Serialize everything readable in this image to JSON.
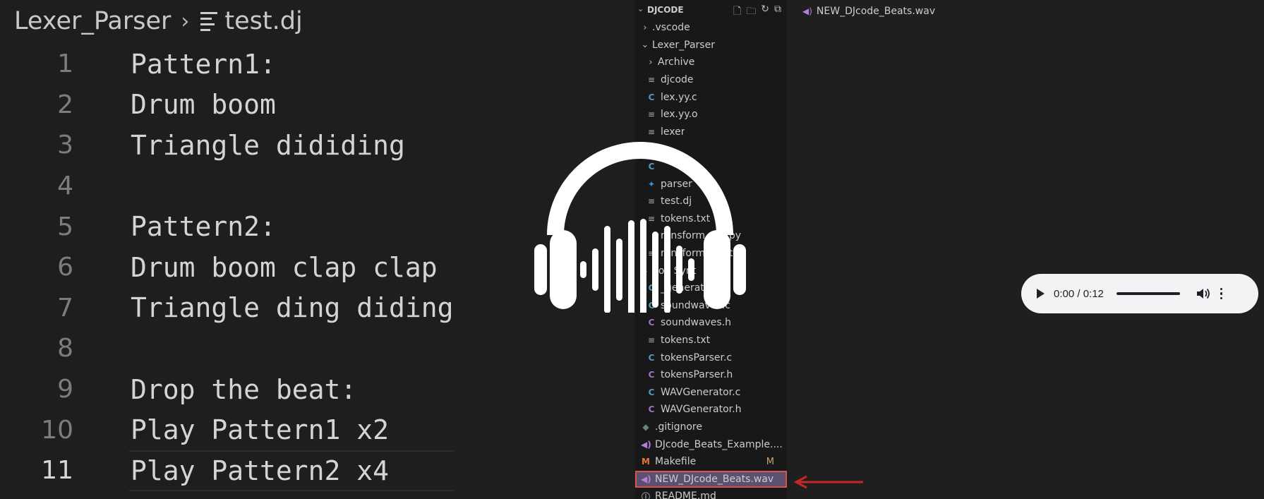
{
  "breadcrumb": {
    "folder": "Lexer_Parser",
    "separator": "›",
    "file": "test.dj"
  },
  "editor": {
    "active_line": 11,
    "lines": [
      {
        "num": "1",
        "text": "Pattern1:"
      },
      {
        "num": "2",
        "text": "Drum boom"
      },
      {
        "num": "3",
        "text": "Triangle dididing"
      },
      {
        "num": "4",
        "text": ""
      },
      {
        "num": "5",
        "text": "Pattern2:"
      },
      {
        "num": "6",
        "text": "Drum boom clap clap"
      },
      {
        "num": "7",
        "text": "Triangle ding diding"
      },
      {
        "num": "8",
        "text": ""
      },
      {
        "num": "9",
        "text": "Drop the beat:"
      },
      {
        "num": "10",
        "text": "Play Pattern1 x2"
      },
      {
        "num": "11",
        "text": "Play Pattern2 x4"
      }
    ]
  },
  "explorer": {
    "title": "DJCODE",
    "items": [
      {
        "label": ".vscode",
        "indent": 1,
        "chevron": "›",
        "icon": "folder"
      },
      {
        "label": "Lexer_Parser",
        "indent": 1,
        "chevron": "⌄",
        "icon": "folder"
      },
      {
        "label": "Archive",
        "indent": 2,
        "chevron": "›",
        "icon": "folder"
      },
      {
        "label": "djcode",
        "indent": 2,
        "chevron": "",
        "icon": "lines"
      },
      {
        "label": "lex.yy.c",
        "indent": 2,
        "chevron": "",
        "icon": "c"
      },
      {
        "label": "lex.yy.o",
        "indent": 2,
        "chevron": "",
        "icon": "lines"
      },
      {
        "label": "lexer",
        "indent": 2,
        "chevron": "",
        "icon": "lines"
      },
      {
        "label": "",
        "indent": 2,
        "chevron": "",
        "icon": "lines"
      },
      {
        "label": "",
        "indent": 2,
        "chevron": "",
        "icon": "c"
      },
      {
        "label": "parser",
        "indent": 2,
        "chevron": "",
        "icon": "py"
      },
      {
        "label": "test.dj",
        "indent": 2,
        "chevron": "",
        "icon": "lines"
      },
      {
        "label": "tokens.txt",
        "indent": 2,
        "chevron": "",
        "icon": "lines"
      },
      {
        "label": "ransform ens.py",
        "indent": 2,
        "chevron": "",
        "icon": "none"
      },
      {
        "label": "ransform ens.txt",
        "indent": 2,
        "chevron": "",
        "icon": "lines"
      },
      {
        "label": "Sou Synt",
        "indent": 1,
        "chevron": "⌄",
        "icon": "folder"
      },
      {
        "label": "_generat",
        "indent": 2,
        "chevron": "",
        "icon": "c"
      },
      {
        "label": "soundwaves.c",
        "indent": 2,
        "chevron": "",
        "icon": "c"
      },
      {
        "label": "soundwaves.h",
        "indent": 2,
        "chevron": "",
        "icon": "h"
      },
      {
        "label": "tokens.txt",
        "indent": 2,
        "chevron": "",
        "icon": "lines"
      },
      {
        "label": "tokensParser.c",
        "indent": 2,
        "chevron": "",
        "icon": "c"
      },
      {
        "label": "tokensParser.h",
        "indent": 2,
        "chevron": "",
        "icon": "h"
      },
      {
        "label": "WAVGenerator.c",
        "indent": 2,
        "chevron": "",
        "icon": "c"
      },
      {
        "label": "WAVGenerator.h",
        "indent": 2,
        "chevron": "",
        "icon": "h"
      },
      {
        "label": ".gitignore",
        "indent": 1,
        "chevron": "",
        "icon": "git"
      },
      {
        "label": "DJcode_Beats_Example....",
        "indent": 1,
        "chevron": "",
        "icon": "audio"
      },
      {
        "label": "Makefile",
        "indent": 1,
        "chevron": "",
        "icon": "m",
        "badge": "M"
      },
      {
        "label": "NEW_DJcode_Beats.wav",
        "indent": 1,
        "chevron": "",
        "icon": "audio",
        "selected": true
      },
      {
        "label": "README.md",
        "indent": 1,
        "chevron": "",
        "icon": "info"
      }
    ]
  },
  "preview_tab": {
    "label": "NEW_DJcode_Beats.wav",
    "icon": "audio-icon"
  },
  "audio_player": {
    "time": "0:00 / 0:12",
    "progress": 0
  },
  "overlay": {
    "icon": "headphones-soundwave-icon"
  },
  "colors": {
    "selection": "#5c5070",
    "highlight_border": "#d9534f",
    "arrow": "#c62828"
  }
}
